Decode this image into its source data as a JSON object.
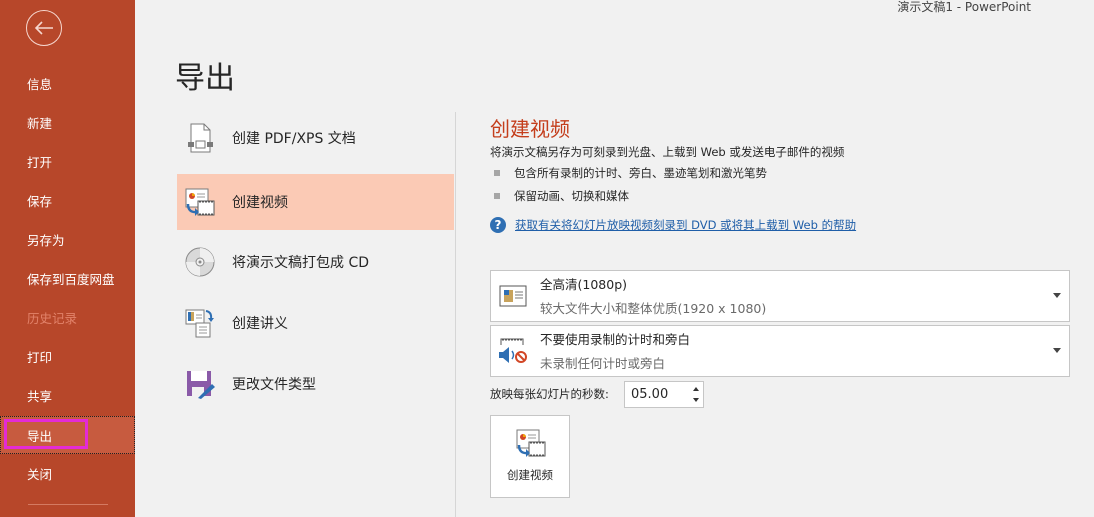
{
  "window": {
    "title": "演示文稿1  -  PowerPoint"
  },
  "sidebar": {
    "back_icon": "back-arrow-circle-icon",
    "items": [
      {
        "label": "信息",
        "state": "normal"
      },
      {
        "label": "新建",
        "state": "normal"
      },
      {
        "label": "打开",
        "state": "normal"
      },
      {
        "label": "保存",
        "state": "normal"
      },
      {
        "label": "另存为",
        "state": "normal"
      },
      {
        "label": "保存到百度网盘",
        "state": "normal"
      },
      {
        "label": "历史记录",
        "state": "disabled"
      },
      {
        "label": "打印",
        "state": "normal"
      },
      {
        "label": "共享",
        "state": "normal"
      },
      {
        "label": "导出",
        "state": "active"
      },
      {
        "label": "关闭",
        "state": "normal"
      }
    ],
    "colors": {
      "background": "#b7472a",
      "active": "#c75b3f",
      "highlight": "#e42ad6"
    }
  },
  "page": {
    "title": "导出"
  },
  "export_options": [
    {
      "label": "创建 PDF/XPS 文档",
      "icon": "pdf-document-icon",
      "selected": false
    },
    {
      "label": "创建视频",
      "icon": "create-video-icon",
      "selected": true
    },
    {
      "label": "将演示文稿打包成 CD",
      "icon": "cd-disc-icon",
      "selected": false
    },
    {
      "label": "创建讲义",
      "icon": "handout-icon",
      "selected": false
    },
    {
      "label": "更改文件类型",
      "icon": "change-file-type-icon",
      "selected": false
    }
  ],
  "detail": {
    "title": "创建视频",
    "description": "将演示文稿另存为可刻录到光盘、上载到 Web 或发送电子邮件的视频",
    "bullets": [
      "包含所有录制的计时、旁白、墨迹笔划和激光笔势",
      "保留动画、切换和媒体"
    ],
    "help_link": "获取有关将幻灯片放映视频刻录到 DVD 或将其上载到 Web 的帮助",
    "quality_dropdown": {
      "selected": "全高清(1080p)",
      "subtitle": "较大文件大小和整体优质(1920 x 1080)",
      "icon": "presentation-quality-icon"
    },
    "timing_dropdown": {
      "selected": "不要使用录制的计时和旁白",
      "subtitle": "未录制任何计时或旁白",
      "icon": "no-narration-icon"
    },
    "seconds_label": "放映每张幻灯片的秒数:",
    "seconds_value": "05.00",
    "create_button_label": "创建视频",
    "accent_color": "#c43e1c"
  }
}
